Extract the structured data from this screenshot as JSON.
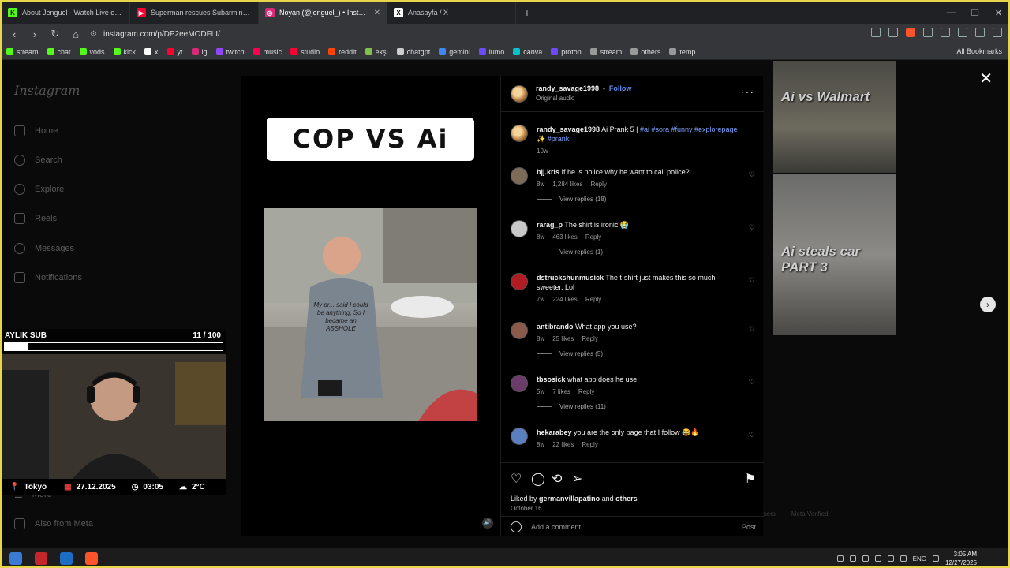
{
  "browser": {
    "tabs": [
      {
        "title": "About Jenguel - Watch Live on Kick",
        "color": "#53fc18",
        "glyph": "K",
        "active": false
      },
      {
        "title": "Superman rescues Subarmine #short",
        "color": "#ff0033",
        "glyph": "▶",
        "active": false
      },
      {
        "title": "Noyan (@jenguel_) • Instagra",
        "color": "#d62976",
        "glyph": "◎",
        "active": true
      },
      {
        "title": "Anasayfa / X",
        "color": "#ffffff",
        "glyph": "X",
        "active": false
      }
    ],
    "url": "instagram.com/p/DP2eeMODFLI/",
    "bookmarks": [
      {
        "label": "stream",
        "color": "#53fc18"
      },
      {
        "label": "chat",
        "color": "#53fc18"
      },
      {
        "label": "vods",
        "color": "#53fc18"
      },
      {
        "label": "kick",
        "color": "#53fc18"
      },
      {
        "label": "x",
        "color": "#ffffff"
      },
      {
        "label": "yt",
        "color": "#ff0033"
      },
      {
        "label": "ig",
        "color": "#d62976"
      },
      {
        "label": "twitch",
        "color": "#9146ff"
      },
      {
        "label": "music",
        "color": "#ff0050"
      },
      {
        "label": "studio",
        "color": "#ff0033"
      },
      {
        "label": "reddit",
        "color": "#ff4500"
      },
      {
        "label": "ekşi",
        "color": "#81c14b"
      },
      {
        "label": "chatgpt",
        "color": "#cccccc"
      },
      {
        "label": "gemini",
        "color": "#4285f4"
      },
      {
        "label": "lumo",
        "color": "#6d4aff"
      },
      {
        "label": "canva",
        "color": "#00c4cc"
      },
      {
        "label": "proton",
        "color": "#6d4aff"
      },
      {
        "label": "stream",
        "color": "#999999"
      },
      {
        "label": "others",
        "color": "#999999"
      },
      {
        "label": "temp",
        "color": "#999999"
      }
    ],
    "all_bookmarks": "All Bookmarks"
  },
  "ig": {
    "logo": "Instagram",
    "nav": [
      "Home",
      "Search",
      "Explore",
      "Reels",
      "Messages",
      "Notifications"
    ],
    "more": "More",
    "also_from_meta": "Also from Meta",
    "bg_thumbs": [
      "Ai vs Walmart",
      "Ai steals car PART 3"
    ],
    "footer": [
      "Users",
      "Meta Verified"
    ]
  },
  "post": {
    "media_title": "COP VS Ai",
    "shirt_text": "My pr... said I could be anything, So I became an ASSHOLE",
    "author": "randy_savage1998",
    "follow": "Follow",
    "audio": "Original audio",
    "caption_user": "randy_savage1998",
    "caption_text": "Ai Prank 5 |",
    "caption_tags": "#ai #sora #funny #explorepage ✨ #prank",
    "caption_age": "10w",
    "comments": [
      {
        "user": "bjj.kris",
        "text": "If he is police why he want to call police?",
        "age": "8w",
        "likes": "1,284 likes",
        "reply": "Reply",
        "view_replies": "View replies (18)"
      },
      {
        "user": "rarag_p",
        "text": "The shirt is ironic 😭",
        "age": "8w",
        "likes": "463 likes",
        "reply": "Reply",
        "view_replies": "View replies (1)"
      },
      {
        "user": "dstruckshunmusick",
        "text": "The t-shirt just makes this so much sweeter. Lol",
        "age": "7w",
        "likes": "224 likes",
        "reply": "Reply",
        "view_replies": ""
      },
      {
        "user": "antibrando",
        "text": "What app you use?",
        "age": "8w",
        "likes": "25 likes",
        "reply": "Reply",
        "view_replies": "View replies (5)"
      },
      {
        "user": "tbsosick",
        "text": "what app does he use",
        "age": "5w",
        "likes": "7 likes",
        "reply": "Reply",
        "view_replies": "View replies (11)"
      },
      {
        "user": "hekarabey",
        "text": "you are the only page that I follow 😂🔥",
        "age": "8w",
        "likes": "22 likes",
        "reply": "Reply",
        "view_replies": ""
      }
    ],
    "liked_by_prefix": "Liked by",
    "liked_by_user": "germanvillapatino",
    "liked_by_and": "and",
    "liked_by_others": "others",
    "date": "October 16",
    "add_comment_placeholder": "Add a comment...",
    "post_label": "Post"
  },
  "overlay": {
    "sub_label": "AYLIK SUB",
    "sub_count": "11 / 100",
    "sub_progress": 0.11,
    "location": "Tokyo",
    "date": "27.12.2025",
    "time": "03:05",
    "weather": "2°C"
  },
  "taskbar": {
    "lang": "ENG",
    "time": "3:05 AM",
    "date": "12/27/2025"
  }
}
